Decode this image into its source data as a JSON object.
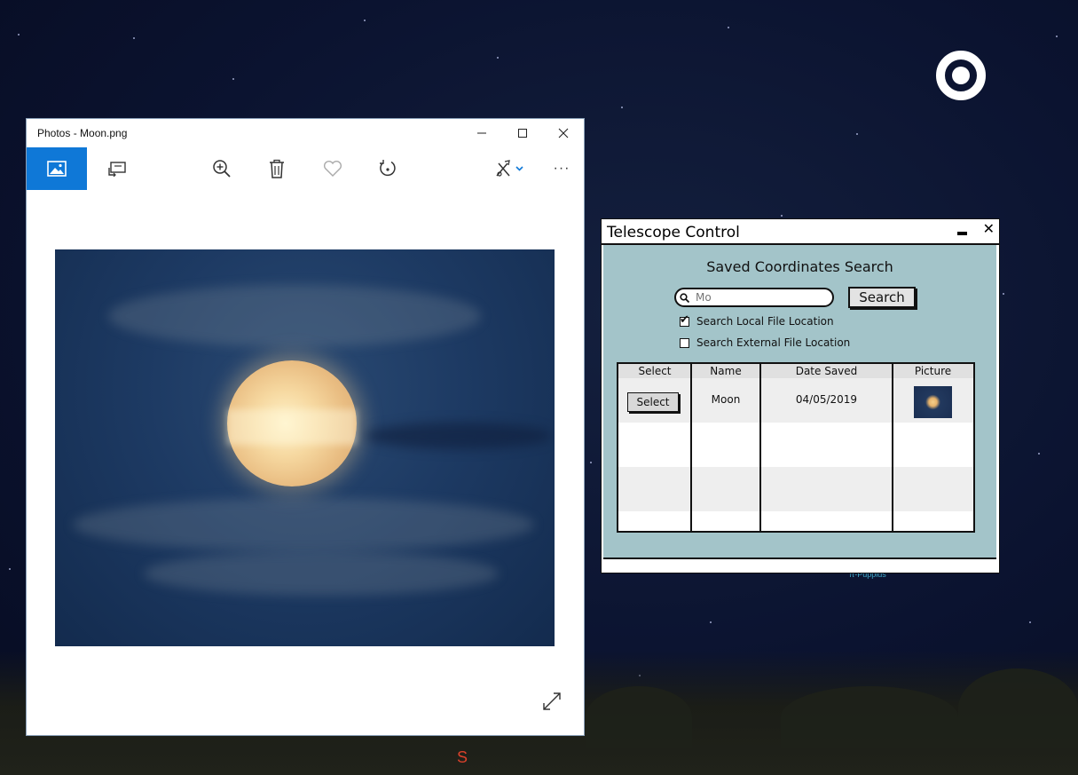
{
  "desktop": {
    "compass_label": "S",
    "star_label": "π-Puppids"
  },
  "photos_window": {
    "title": "Photos - Moon.png",
    "controls": {
      "minimize": "—",
      "maximize": "☐",
      "close": "✕"
    },
    "toolbar": {
      "view_icon": "image-icon",
      "slideshow_icon": "slideshow-icon",
      "zoom_icon": "zoom-in-icon",
      "delete_icon": "trash-icon",
      "favorite_icon": "heart-icon",
      "rotate_icon": "rotate-icon",
      "edit_icon": "edit-create-icon",
      "more_label": "···"
    },
    "image_subject": "moon"
  },
  "telescope_window": {
    "title": "Telescope Control",
    "close_label": "✕",
    "heading": "Saved Coordinates Search",
    "search": {
      "value": "",
      "placeholder": "Mo",
      "button_label": "Search"
    },
    "checkboxes": [
      {
        "label": "Search Local File Location",
        "checked": true
      },
      {
        "label": "Search External File Location",
        "checked": false
      }
    ],
    "table": {
      "headers": [
        "Select",
        "Name",
        "Date Saved",
        "Picture"
      ],
      "rows": [
        {
          "select_label": "Select",
          "name": "Moon",
          "date_saved": "04/05/2019",
          "picture": "moon-thumbnail"
        }
      ]
    }
  },
  "colors": {
    "accent": "#0f78d7",
    "telescope_panel": "#a3c4c9",
    "compass_red": "#d9412b"
  }
}
